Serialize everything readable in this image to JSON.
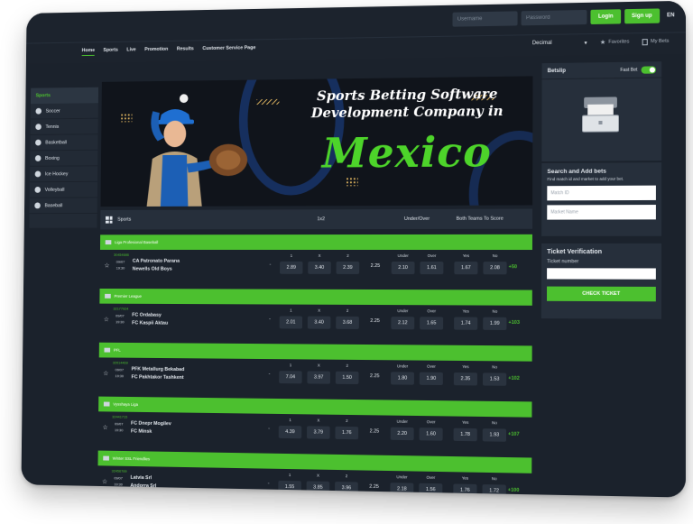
{
  "auth": {
    "username_placeholder": "Username",
    "password_placeholder": "Password",
    "login_label": "Login",
    "signup_label": "Sign up",
    "language": "EN"
  },
  "nav": {
    "items": [
      "Home",
      "Sports",
      "Live",
      "Promotion",
      "Results",
      "Customer Service Page"
    ],
    "odds_format": "Decimal",
    "favorites_label": "Favorites",
    "mybets_label": "My Bets"
  },
  "sidebar": {
    "header": "Sports",
    "items": [
      "Soccer",
      "Tennis",
      "Basketball",
      "Boxing",
      "Ice Hockey",
      "Volleyball",
      "Baseball"
    ]
  },
  "banner": {
    "title_line1": "Sports Betting Software",
    "title_line2": "Development Company in",
    "country": "Mexico"
  },
  "table": {
    "sports_label": "Sports",
    "col_1x2": "1x2",
    "col_under_over": "Under/Over",
    "col_btts": "Both Teams To Score",
    "labels": {
      "one": "1",
      "x": "X",
      "two": "2",
      "under": "Under",
      "over": "Over",
      "yes": "Yes",
      "no": "No"
    },
    "dash": "-",
    "matches": [
      {
        "league": "Liga Profesional Baseball",
        "code": "30454686",
        "date": "09/07",
        "time": "19:30",
        "home": "CA Patronato Parana",
        "away": "Newells Old Boys",
        "o1": "2.89",
        "ox": "3.40",
        "o2": "2.39",
        "total": "2.25",
        "under": "2.10",
        "over": "1.61",
        "yes": "1.67",
        "no": "2.08",
        "more": "+50"
      },
      {
        "league": "Premier League",
        "code": "32177924",
        "date": "09/07",
        "time": "19:30",
        "home": "FC Ordabasy",
        "away": "FC Kaspii Aktau",
        "o1": "2.01",
        "ox": "3.40",
        "o2": "3.68",
        "total": "2.25",
        "under": "2.12",
        "over": "1.65",
        "yes": "1.74",
        "no": "1.99",
        "more": "+103"
      },
      {
        "league": "PFL",
        "code": "32014469",
        "date": "09/07",
        "time": "19:30",
        "home": "PFK Metallurg Bekabad",
        "away": "FC Pakhtakor Tashkent",
        "o1": "7.04",
        "ox": "3.97",
        "o2": "1.50",
        "total": "2.25",
        "under": "1.80",
        "over": "1.90",
        "yes": "2.35",
        "no": "1.53",
        "more": "+102"
      },
      {
        "league": "Vysshaya Liga",
        "code": "32441715",
        "date": "09/07",
        "time": "19:30",
        "home": "FC Dnepr Mogilev",
        "away": "FC Minsk",
        "o1": "4.39",
        "ox": "3.79",
        "o2": "1.76",
        "total": "2.25",
        "under": "2.20",
        "over": "1.60",
        "yes": "1.78",
        "no": "1.93",
        "more": "+107"
      },
      {
        "league": "Winter SSL Friendlies",
        "code": "32456789",
        "date": "09/07",
        "time": "19:30",
        "home": "Latvia Srl",
        "away": "Andorra Srl",
        "o1": "1.55",
        "ox": "3.85",
        "o2": "3.96",
        "total": "2.25",
        "under": "2.18",
        "over": "1.56",
        "yes": "1.76",
        "no": "1.72",
        "more": "+100"
      }
    ]
  },
  "betslip": {
    "title": "Betslip",
    "fast_bet_label": "Fast Bet"
  },
  "add_bets": {
    "title": "Search and Add bets",
    "subtitle": "Find match id and market to add your bet.",
    "match_placeholder": "Match ID",
    "market_placeholder": "Market Name"
  },
  "ticket": {
    "title": "Ticket Verification",
    "number_label": "Ticket number",
    "check_label": "CHECK TICKET"
  },
  "colors": {
    "accent": "#4cc02f",
    "bg": "#1b222c",
    "panel": "#262f3b"
  }
}
